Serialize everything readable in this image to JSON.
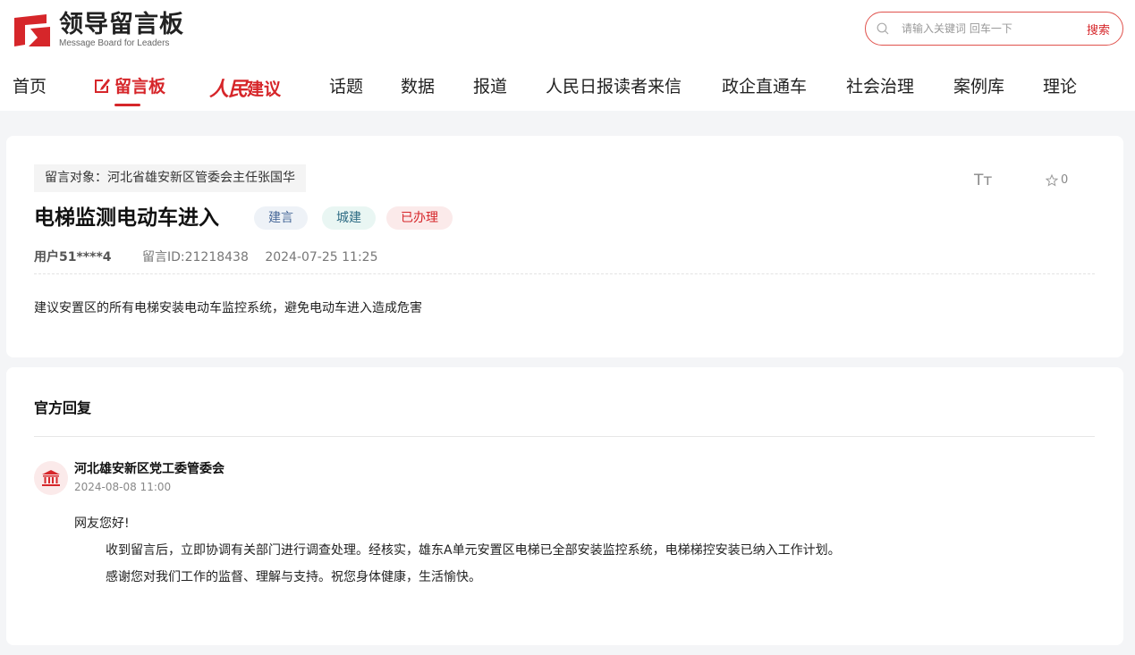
{
  "brand": {
    "title": "领导留言板",
    "subtitle": "Message Board for Leaders",
    "accent_color": "#d6262a"
  },
  "search": {
    "placeholder": "请输入关键词 回车一下",
    "button_label": "搜索"
  },
  "nav": {
    "items": [
      {
        "label": "首页"
      },
      {
        "label": "留言板",
        "active": true
      },
      {
        "label_script": "人民",
        "label": "建议"
      },
      {
        "label": "话题"
      },
      {
        "label": "数据"
      },
      {
        "label": "报道"
      },
      {
        "label": "人民日报读者来信"
      },
      {
        "label": "政企直通车"
      },
      {
        "label": "社会治理"
      },
      {
        "label": "案例库"
      },
      {
        "label": "理论"
      }
    ]
  },
  "message": {
    "target": "留言对象：河北省雄安新区管委会主任张国华",
    "title": "电梯监测电动车进入",
    "tags": [
      "建言",
      "城建",
      "已办理"
    ],
    "font_size_icon_label": "Tт",
    "favorite_count": "0",
    "user": "用户51****4",
    "message_id": "留言ID:21218438",
    "datetime": "2024-07-25 11:25",
    "body": "建议安置区的所有电梯安装电动车监控系统，避免电动车进入造成危害"
  },
  "reply": {
    "heading": "官方回复",
    "org_name": "河北雄安新区党工委管委会",
    "datetime": "2024-08-08 11:00",
    "greeting": "网友您好!",
    "paragraph1": "收到留言后，立即协调有关部门进行调查处理。经核实，雄东A单元安置区电梯已全部安装监控系统，电梯梯控安装已纳入工作计划。",
    "paragraph2": "感谢您对我们工作的监督、理解与支持。祝您身体健康，生活愉快。"
  }
}
